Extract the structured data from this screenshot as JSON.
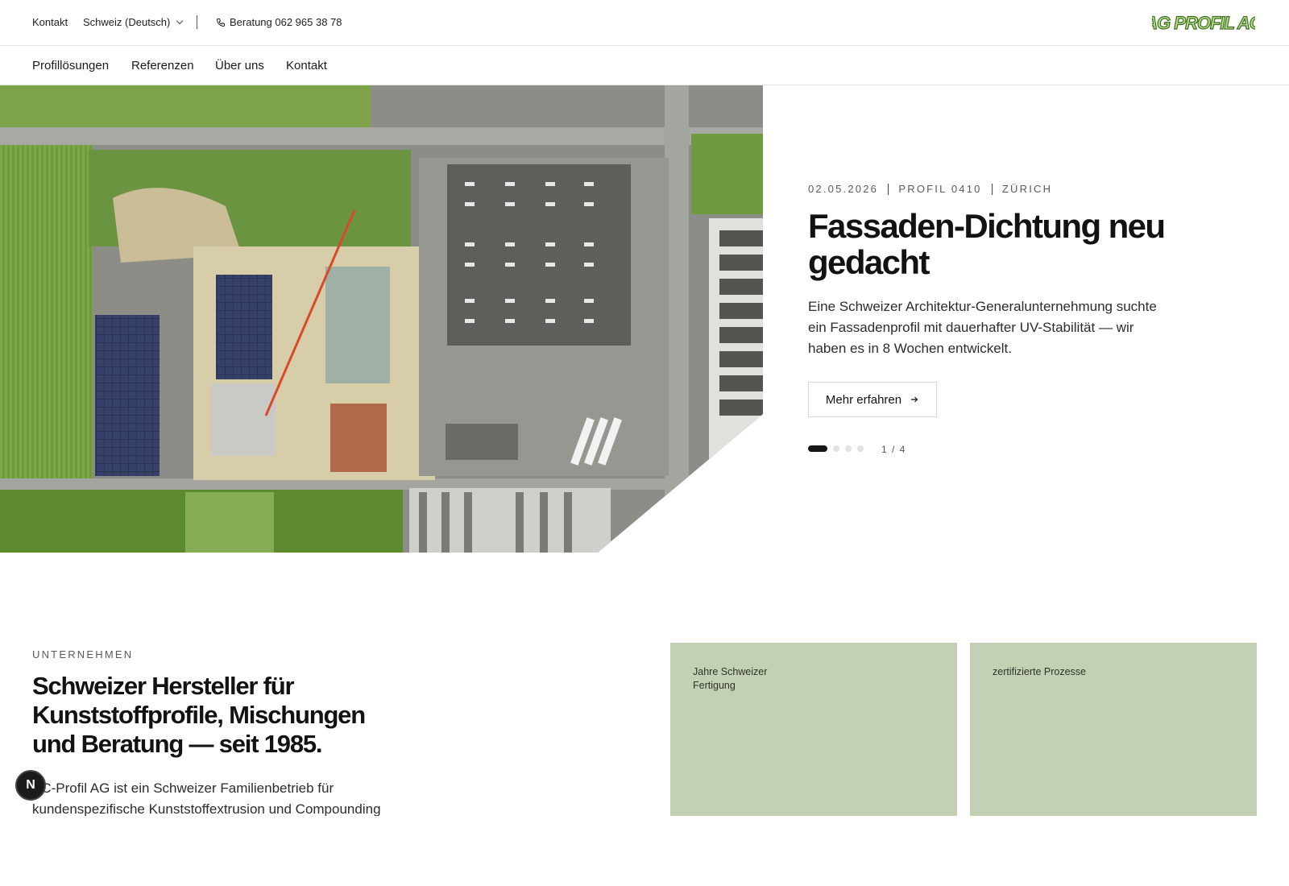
{
  "topbar": {
    "contact": "Kontakt",
    "language": "Schweiz (Deutsch)",
    "phone_label": "Beratung 062 965 38 78",
    "logo_text": "AG PROFIL AG"
  },
  "nav": {
    "items": [
      "Profillösungen",
      "Referenzen",
      "Über uns",
      "Kontakt"
    ]
  },
  "hero": {
    "date": "02.05.2026",
    "profile": "PROFIL 0410",
    "city": "ZÜRICH",
    "title": "Fassaden-Dichtung neu gedacht",
    "description": "Eine Schweizer Architektur-Generalunternehmung suchte ein Fassadenprofil mit dauerhafter UV-Stabilität — wir haben es in 8 Wochen entwickelt.",
    "cta_label": "Mehr erfahren",
    "slide_current": 1,
    "slide_total": 4,
    "pager_text": "1 / 4"
  },
  "company": {
    "eyebrow": "UNTERNEHMEN",
    "title": "Schweizer Hersteller für Kunststoffprofile, Mischungen und Beratung — seit 1985.",
    "text": "AC-Profil AG ist ein Schweizer Familienbetrieb für kundenspezifische Kunststoffextrusion und Compounding",
    "stats": [
      {
        "label": "Jahre Schweizer Fertigung"
      },
      {
        "label": "zertifizierte Prozesse"
      }
    ]
  },
  "badge": {
    "letter": "N"
  },
  "colors": {
    "accent_card": "#c3d0b3",
    "logo_green": "#8fc24f",
    "text_dark": "#121212"
  }
}
